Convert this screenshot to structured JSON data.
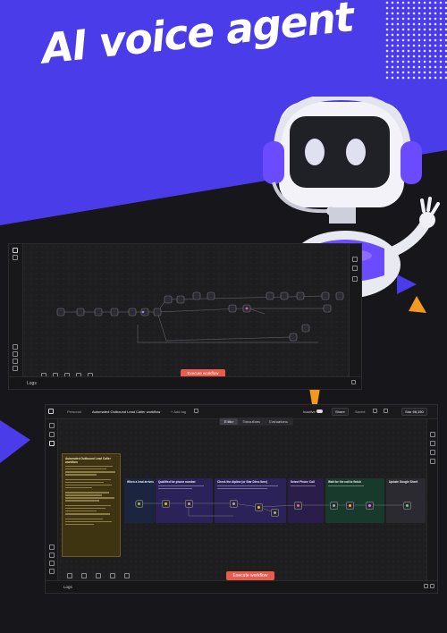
{
  "hero": {
    "headline": "AI voice agent",
    "colors": {
      "purple": "#4a3ce8",
      "orange": "#f39a1e",
      "dark": "#17161b"
    }
  },
  "window1": {
    "execute_label": "Execute workflow",
    "logs_label": "Logs",
    "icons": [
      "zoom-fit-icon",
      "zoom-in-icon",
      "zoom-out-icon",
      "undo-icon",
      "clean-icon"
    ]
  },
  "window2": {
    "breadcrumb_personal": "Personal",
    "workflow_title": "Automated Outbound Lead Caller workflow",
    "add_tag": "+ Add tag",
    "inactive_label": "Inactive",
    "share_label": "Share",
    "saved_label": "Saved",
    "star_label": "Star",
    "star_count": "98,150",
    "tabs": [
      "Editor",
      "Executions",
      "Evaluations"
    ],
    "note_title": "Automated Outbound Lead Caller workflow",
    "sections": [
      {
        "title": "When a lead arrives",
        "color": "#1c2540"
      },
      {
        "title": "Qualified for phone number",
        "color": "#2a2258"
      },
      {
        "title": "Check the dipline (or Star Direc time)",
        "color": "#2a2258"
      },
      {
        "title": "Select Phone Call",
        "color": "#2b1d4a"
      },
      {
        "title": "Wait for the call to finish",
        "color": "#183a2c"
      },
      {
        "title": "Update Google Sheet",
        "color": "#2a2a30"
      }
    ],
    "execute_label": "Execute workflow",
    "logs_label": "Logs"
  }
}
